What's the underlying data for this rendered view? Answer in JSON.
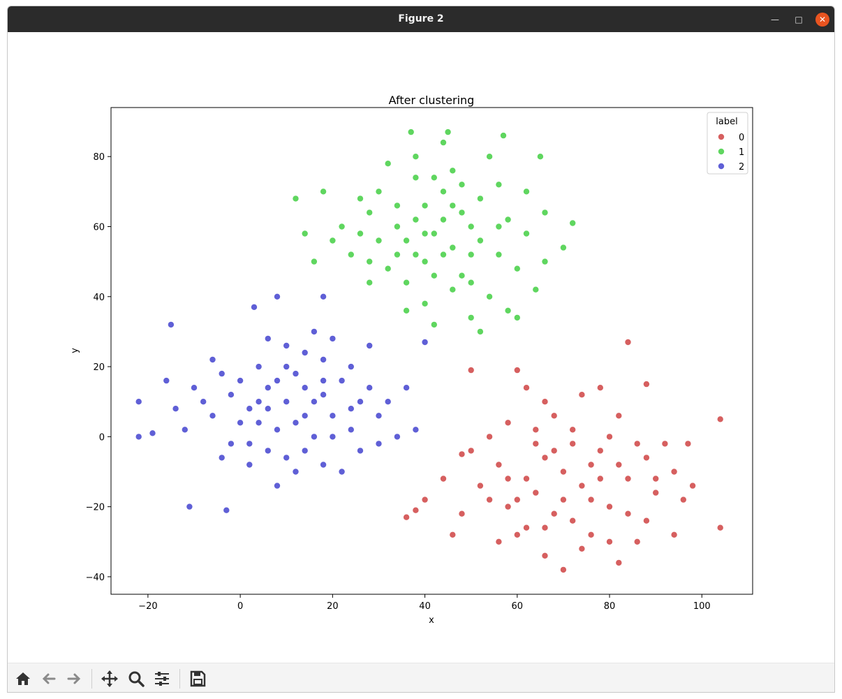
{
  "window": {
    "title": "Figure 2"
  },
  "toolbar": {
    "buttons": [
      {
        "name": "home-icon"
      },
      {
        "name": "back-icon"
      },
      {
        "name": "forward-icon"
      },
      {
        "name": "pan-icon"
      },
      {
        "name": "zoom-icon"
      },
      {
        "name": "configure-subplots-icon"
      },
      {
        "name": "save-icon"
      }
    ]
  },
  "chart_data": {
    "type": "scatter",
    "title": "After clustering",
    "xlabel": "x",
    "ylabel": "y",
    "xlim": [
      -28,
      111
    ],
    "ylim": [
      -45,
      94
    ],
    "xticks": [
      -20,
      0,
      20,
      40,
      60,
      80,
      100
    ],
    "yticks": [
      -40,
      -20,
      0,
      20,
      40,
      60,
      80
    ],
    "xtick_labels": [
      "−20",
      "0",
      "20",
      "40",
      "60",
      "80",
      "100"
    ],
    "ytick_labels": [
      "−40",
      "−20",
      "0",
      "20",
      "40",
      "60",
      "80"
    ],
    "grid": false,
    "legend": {
      "title": "label",
      "placement": "top-right"
    },
    "series": [
      {
        "name": "0",
        "color": "#d65f5f",
        "points": [
          [
            70,
            -10
          ],
          [
            66,
            -6
          ],
          [
            74,
            -14
          ],
          [
            60,
            -18
          ],
          [
            78,
            -4
          ],
          [
            68,
            -22
          ],
          [
            84,
            -12
          ],
          [
            56,
            -8
          ],
          [
            72,
            2
          ],
          [
            80,
            -20
          ],
          [
            64,
            -2
          ],
          [
            88,
            -6
          ],
          [
            62,
            -26
          ],
          [
            76,
            -28
          ],
          [
            52,
            -14
          ],
          [
            90,
            -16
          ],
          [
            58,
            4
          ],
          [
            82,
            6
          ],
          [
            66,
            -34
          ],
          [
            94,
            -10
          ],
          [
            48,
            -22
          ],
          [
            74,
            12
          ],
          [
            86,
            -30
          ],
          [
            54,
            0
          ],
          [
            70,
            -18
          ],
          [
            78,
            -12
          ],
          [
            68,
            -4
          ],
          [
            62,
            -12
          ],
          [
            86,
            -2
          ],
          [
            72,
            -24
          ],
          [
            58,
            -20
          ],
          [
            80,
            0
          ],
          [
            92,
            -2
          ],
          [
            64,
            -16
          ],
          [
            76,
            -8
          ],
          [
            84,
            -22
          ],
          [
            60,
            -28
          ],
          [
            68,
            6
          ],
          [
            74,
            -32
          ],
          [
            88,
            -24
          ],
          [
            50,
            -4
          ],
          [
            96,
            -18
          ],
          [
            66,
            10
          ],
          [
            78,
            14
          ],
          [
            56,
            -30
          ],
          [
            82,
            -36
          ],
          [
            70,
            -38
          ],
          [
            98,
            -14
          ],
          [
            62,
            14
          ],
          [
            46,
            -28
          ],
          [
            44,
            -12
          ],
          [
            40,
            -18
          ],
          [
            104,
            5
          ],
          [
            104,
            -26
          ],
          [
            84,
            27
          ],
          [
            36,
            -23
          ],
          [
            38,
            -21
          ],
          [
            60,
            19
          ],
          [
            50,
            19
          ],
          [
            88,
            15
          ],
          [
            97,
            -2
          ],
          [
            48,
            -5
          ],
          [
            94,
            -28
          ],
          [
            82,
            -8
          ],
          [
            72,
            -2
          ],
          [
            58,
            -12
          ],
          [
            90,
            -12
          ],
          [
            66,
            -26
          ],
          [
            76,
            -18
          ],
          [
            64,
            2
          ],
          [
            80,
            -30
          ],
          [
            54,
            -18
          ]
        ]
      },
      {
        "name": "1",
        "color": "#5fd65f",
        "points": [
          [
            42,
            58
          ],
          [
            38,
            62
          ],
          [
            46,
            54
          ],
          [
            34,
            66
          ],
          [
            50,
            60
          ],
          [
            40,
            50
          ],
          [
            44,
            70
          ],
          [
            30,
            56
          ],
          [
            48,
            46
          ],
          [
            36,
            44
          ],
          [
            52,
            68
          ],
          [
            28,
            64
          ],
          [
            56,
            52
          ],
          [
            32,
            48
          ],
          [
            46,
            76
          ],
          [
            40,
            38
          ],
          [
            54,
            40
          ],
          [
            26,
            58
          ],
          [
            58,
            62
          ],
          [
            38,
            74
          ],
          [
            24,
            52
          ],
          [
            44,
            62
          ],
          [
            50,
            52
          ],
          [
            36,
            56
          ],
          [
            42,
            46
          ],
          [
            48,
            64
          ],
          [
            34,
            60
          ],
          [
            30,
            70
          ],
          [
            56,
            72
          ],
          [
            52,
            56
          ],
          [
            40,
            66
          ],
          [
            46,
            42
          ],
          [
            26,
            68
          ],
          [
            60,
            48
          ],
          [
            22,
            60
          ],
          [
            62,
            58
          ],
          [
            36,
            36
          ],
          [
            50,
            34
          ],
          [
            58,
            36
          ],
          [
            44,
            84
          ],
          [
            38,
            80
          ],
          [
            62,
            70
          ],
          [
            20,
            56
          ],
          [
            66,
            64
          ],
          [
            18,
            70
          ],
          [
            14,
            58
          ],
          [
            12,
            68
          ],
          [
            64,
            42
          ],
          [
            28,
            44
          ],
          [
            42,
            32
          ],
          [
            54,
            80
          ],
          [
            32,
            78
          ],
          [
            48,
            72
          ],
          [
            40,
            58
          ],
          [
            44,
            52
          ],
          [
            34,
            52
          ],
          [
            50,
            44
          ],
          [
            28,
            50
          ],
          [
            56,
            60
          ],
          [
            46,
            66
          ],
          [
            38,
            52
          ],
          [
            42,
            74
          ],
          [
            70,
            54
          ],
          [
            66,
            50
          ],
          [
            57,
            86
          ],
          [
            45,
            87
          ],
          [
            37,
            87
          ],
          [
            65,
            80
          ],
          [
            72,
            61
          ],
          [
            60,
            34
          ],
          [
            52,
            30
          ],
          [
            16,
            50
          ]
        ]
      },
      {
        "name": "2",
        "color": "#5f5fd6",
        "points": [
          [
            10,
            10
          ],
          [
            6,
            14
          ],
          [
            14,
            6
          ],
          [
            2,
            8
          ],
          [
            18,
            12
          ],
          [
            8,
            2
          ],
          [
            12,
            18
          ],
          [
            -2,
            12
          ],
          [
            16,
            0
          ],
          [
            4,
            20
          ],
          [
            20,
            6
          ],
          [
            0,
            4
          ],
          [
            22,
            16
          ],
          [
            6,
            -4
          ],
          [
            14,
            24
          ],
          [
            -6,
            6
          ],
          [
            24,
            2
          ],
          [
            -4,
            18
          ],
          [
            10,
            -6
          ],
          [
            18,
            22
          ],
          [
            26,
            10
          ],
          [
            2,
            -2
          ],
          [
            28,
            14
          ],
          [
            -8,
            10
          ],
          [
            12,
            4
          ],
          [
            8,
            16
          ],
          [
            16,
            10
          ],
          [
            4,
            10
          ],
          [
            20,
            0
          ],
          [
            0,
            16
          ],
          [
            24,
            20
          ],
          [
            14,
            -4
          ],
          [
            -2,
            -2
          ],
          [
            10,
            26
          ],
          [
            30,
            6
          ],
          [
            -10,
            14
          ],
          [
            18,
            -8
          ],
          [
            6,
            28
          ],
          [
            32,
            10
          ],
          [
            -12,
            2
          ],
          [
            22,
            -10
          ],
          [
            2,
            -8
          ],
          [
            26,
            -4
          ],
          [
            -6,
            22
          ],
          [
            34,
            0
          ],
          [
            12,
            -10
          ],
          [
            -14,
            8
          ],
          [
            16,
            30
          ],
          [
            36,
            14
          ],
          [
            8,
            -14
          ],
          [
            28,
            26
          ],
          [
            -4,
            -6
          ],
          [
            30,
            -2
          ],
          [
            20,
            28
          ],
          [
            38,
            2
          ],
          [
            -16,
            16
          ],
          [
            4,
            4
          ],
          [
            14,
            14
          ],
          [
            10,
            20
          ],
          [
            24,
            8
          ],
          [
            6,
            8
          ],
          [
            18,
            16
          ],
          [
            -22,
            10
          ],
          [
            -22,
            0
          ],
          [
            -19,
            1
          ],
          [
            -11,
            -20
          ],
          [
            -3,
            -21
          ],
          [
            -15,
            32
          ],
          [
            3,
            37
          ],
          [
            8,
            40
          ],
          [
            18,
            40
          ],
          [
            40,
            27
          ]
        ]
      }
    ]
  }
}
